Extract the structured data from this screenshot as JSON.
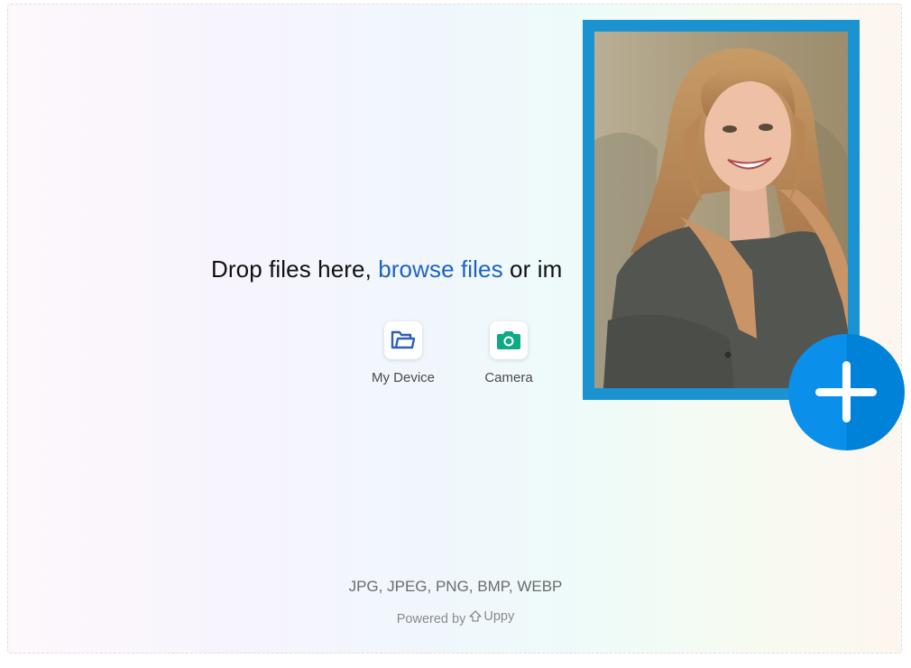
{
  "dropzone": {
    "prompt_prefix": "Drop files here,",
    "browse_label": "browse files",
    "prompt_suffix": "or im",
    "sources": [
      {
        "label": "My Device",
        "icon": "folder-icon"
      },
      {
        "label": "Camera",
        "icon": "camera-icon"
      }
    ],
    "formats": "JPG, JPEG, PNG, BMP, WEBP",
    "powered_by_prefix": "Powered by",
    "powered_by_brand": "Uppy"
  },
  "overlay": {
    "photo": "portrait-photo",
    "add_icon": "plus-icon"
  },
  "colors": {
    "link": "#1f63c4",
    "frame": "#1b93d0",
    "add_button": "#0a8fea",
    "folder_icon": "#2e5fb8",
    "camera_icon": "#0daa85"
  }
}
